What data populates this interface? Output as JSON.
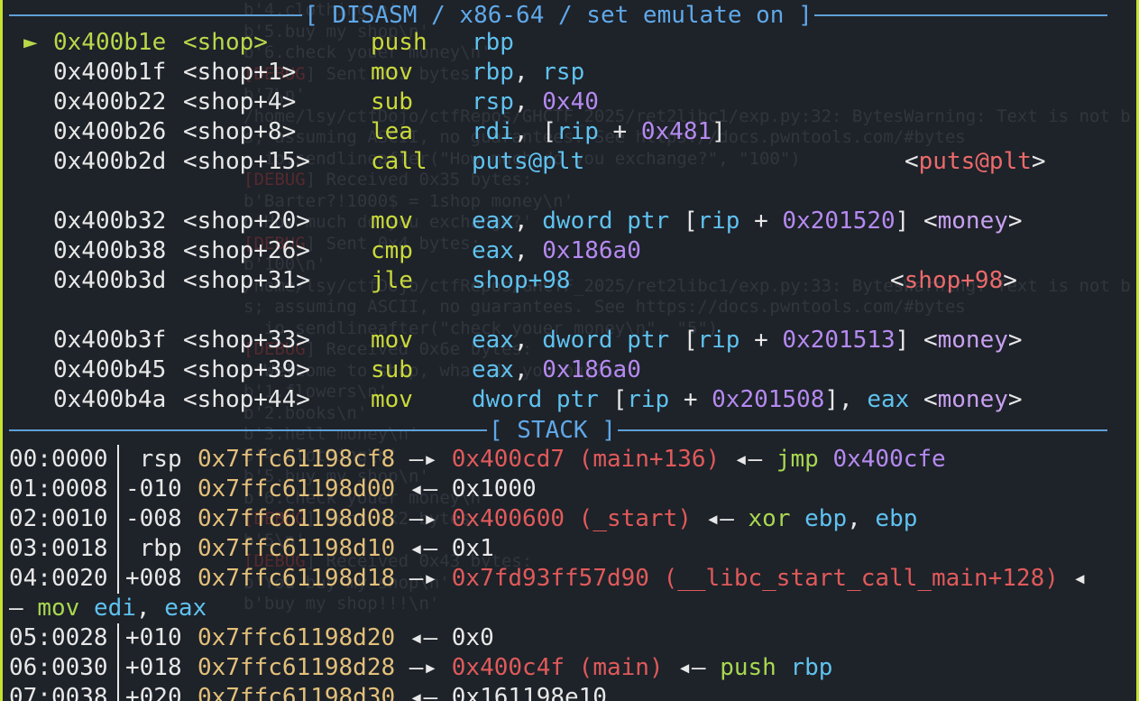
{
  "ghost_lines": [
    {
      "text": "b'4.clothing\\n'",
      "debug": ""
    },
    {
      "text": "b'5.buy my shop\\n'",
      "debug": ""
    },
    {
      "text": "b'6.check youer money\\n'",
      "debug": ""
    },
    {
      "text": "] Sent 0x2 bytes:",
      "debug": "[DEBUG"
    },
    {
      "text": "b'7\\n'",
      "debug": ""
    },
    {
      "text": "/home/lsy/ctfDojo/ctfRepos/GHCTF_2025/ret2libc1/exp.py:32: BytesWarning: Text is not byte",
      "debug": ""
    },
    {
      "text": "s; assuming ASCII, no guarantees. See https://docs.pwntools.com/#bytes",
      "debug": ""
    },
    {
      "text": "  io.sendlineafter(\"How much do you exchange?\", \"100\")",
      "debug": ""
    },
    {
      "text": "] Received 0x35 bytes:",
      "debug": "[DEBUG"
    },
    {
      "text": "b'Barter?!1000$ = 1shop money\\n'",
      "debug": ""
    },
    {
      "text": "b'How much do you exchange?'",
      "debug": ""
    },
    {
      "text": "] Sent 0x4 bytes:",
      "debug": "[DEBUG"
    },
    {
      "text": "b'100\\n'",
      "debug": ""
    },
    {
      "text": "/home/lsy/ctfDojo/ctfRepos/GHCTF_2025/ret2libc1/exp.py:33: BytesWarning: Text is not byte",
      "debug": ""
    },
    {
      "text": "s; assuming ASCII, no guarantees. See https://docs.pwntools.com/#bytes",
      "debug": ""
    },
    {
      "text": "  io.sendlineafter(\"check youer money\\n\", \"5\")",
      "debug": ""
    },
    {
      "text": "] Received 0x6e bytes:",
      "debug": "[DEBUG"
    },
    {
      "text": "b'Welcome to shop, what do you buy?\\n'",
      "debug": ""
    },
    {
      "text": "b'1.flowers\\n'",
      "debug": ""
    },
    {
      "text": "b'2.books\\n'",
      "debug": ""
    },
    {
      "text": "b'3.hell money\\n'",
      "debug": ""
    },
    {
      "text": "b'4.clothing\\n'",
      "debug": ""
    },
    {
      "text": "b'5.buy my shop\\n'",
      "debug": ""
    },
    {
      "text": "b'6.check youer money\\n'",
      "debug": ""
    },
    {
      "text": "] Sent 0x2 bytes:",
      "debug": "[DEBUG"
    },
    {
      "text": "b'5\\n'",
      "debug": ""
    },
    {
      "text": "] Received 0x43 bytes:",
      "debug": "[DEBUG"
    },
    {
      "text": "b'You buy my shop\\n'",
      "debug": ""
    },
    {
      "text": "b'buy my shop!!!\\n'",
      "debug": ""
    }
  ],
  "disasm": {
    "title": "[ DISASM / x86-64 / set emulate on ]",
    "current_marker": "►",
    "rows": [
      {
        "addr": "0x400b1e",
        "sym": "<shop>",
        "mn": "push",
        "ops": [
          [
            "op",
            "rbp"
          ]
        ],
        "ann": [],
        "current": true
      },
      {
        "addr": "0x400b1f",
        "sym": "<shop+1>",
        "mn": "mov",
        "ops": [
          [
            "op",
            "rbp"
          ],
          [
            "white",
            ", "
          ],
          [
            "op",
            "rsp"
          ]
        ],
        "ann": []
      },
      {
        "addr": "0x400b22",
        "sym": "<shop+4>",
        "mn": "sub",
        "ops": [
          [
            "op",
            "rsp"
          ],
          [
            "white",
            ", "
          ],
          [
            "num",
            "0x40"
          ]
        ],
        "ann": []
      },
      {
        "addr": "0x400b26",
        "sym": "<shop+8>",
        "mn": "lea",
        "ops": [
          [
            "op",
            "rdi"
          ],
          [
            "white",
            ", ["
          ],
          [
            "op",
            "rip"
          ],
          [
            "white",
            " + "
          ],
          [
            "num",
            "0x481"
          ],
          [
            "white",
            "]"
          ]
        ],
        "ann": []
      },
      {
        "addr": "0x400b2d",
        "sym": "<shop+15>",
        "mn": "call",
        "ops": [
          [
            "op",
            "puts@plt"
          ]
        ],
        "ann": [
          [
            "white",
            "<"
          ],
          [
            "pink",
            "puts@plt"
          ],
          [
            "white",
            ">"
          ]
        ],
        "ann_col": 1003
      },
      {
        "blank": true
      },
      {
        "addr": "0x400b32",
        "sym": "<shop+20>",
        "mn": "mov",
        "ops": [
          [
            "op",
            "eax"
          ],
          [
            "white",
            ", "
          ],
          [
            "op",
            "dword ptr"
          ],
          [
            "white",
            " ["
          ],
          [
            "op",
            "rip"
          ],
          [
            "white",
            " + "
          ],
          [
            "num",
            "0x201520"
          ],
          [
            "white",
            "]"
          ]
        ],
        "ann": [
          [
            "white",
            " <"
          ],
          [
            "sym",
            "money"
          ],
          [
            "white",
            ">"
          ]
        ]
      },
      {
        "addr": "0x400b38",
        "sym": "<shop+26>",
        "mn": "cmp",
        "ops": [
          [
            "op",
            "eax"
          ],
          [
            "white",
            ", "
          ],
          [
            "num",
            "0x186a0"
          ]
        ],
        "ann": []
      },
      {
        "addr": "0x400b3d",
        "sym": "<shop+31>",
        "mn": "jle",
        "ops": [
          [
            "op",
            "shop+98"
          ]
        ],
        "ann": [
          [
            "white",
            "<"
          ],
          [
            "pink",
            "shop+98"
          ],
          [
            "white",
            ">"
          ]
        ],
        "ann_col": 987
      },
      {
        "blank": true
      },
      {
        "addr": "0x400b3f",
        "sym": "<shop+33>",
        "mn": "mov",
        "ops": [
          [
            "op",
            "eax"
          ],
          [
            "white",
            ", "
          ],
          [
            "op",
            "dword ptr"
          ],
          [
            "white",
            " ["
          ],
          [
            "op",
            "rip"
          ],
          [
            "white",
            " + "
          ],
          [
            "num",
            "0x201513"
          ],
          [
            "white",
            "]"
          ]
        ],
        "ann": [
          [
            "white",
            " <"
          ],
          [
            "sym",
            "money"
          ],
          [
            "white",
            ">"
          ]
        ]
      },
      {
        "addr": "0x400b45",
        "sym": "<shop+39>",
        "mn": "sub",
        "ops": [
          [
            "op",
            "eax"
          ],
          [
            "white",
            ", "
          ],
          [
            "num",
            "0x186a0"
          ]
        ],
        "ann": []
      },
      {
        "addr": "0x400b4a",
        "sym": "<shop+44>",
        "mn": "mov",
        "ops": [
          [
            "op",
            "dword ptr"
          ],
          [
            "white",
            " ["
          ],
          [
            "op",
            "rip"
          ],
          [
            "white",
            " + "
          ],
          [
            "num",
            "0x201508"
          ],
          [
            "white",
            "], "
          ],
          [
            "op",
            "eax"
          ]
        ],
        "ann": [
          [
            "white",
            " <"
          ],
          [
            "sym",
            "money"
          ],
          [
            "white",
            ">"
          ]
        ]
      }
    ]
  },
  "stack": {
    "title": "[ STACK ]",
    "rows": [
      {
        "idx": "00:0000",
        "reg": " rsp",
        "addr": "0x7ffc61198cf8",
        "chain": [
          [
            "white",
            " —▸ "
          ],
          [
            "code",
            "0x400cd7 (main+136)"
          ],
          [
            "white",
            " ◂— "
          ],
          [
            "instr",
            "jmp "
          ],
          [
            "num",
            "0x400cfe"
          ]
        ]
      },
      {
        "idx": "01:0008",
        "reg": "-010",
        "addr": "0x7ffc61198d00",
        "chain": [
          [
            "white",
            " ◂— 0x1000"
          ]
        ]
      },
      {
        "idx": "02:0010",
        "reg": "-008",
        "addr": "0x7ffc61198d08",
        "chain": [
          [
            "white",
            " —▸ "
          ],
          [
            "code",
            "0x400600 (_start)"
          ],
          [
            "white",
            " ◂— "
          ],
          [
            "instr",
            "xor "
          ],
          [
            "op",
            "ebp"
          ],
          [
            "white",
            ", "
          ],
          [
            "op",
            "ebp"
          ]
        ]
      },
      {
        "idx": "03:0018",
        "reg": " rbp",
        "addr": "0x7ffc61198d10",
        "chain": [
          [
            "white",
            " ◂— 0x1"
          ]
        ]
      },
      {
        "idx": "04:0020",
        "reg": "+008",
        "addr": "0x7ffc61198d18",
        "chain": [
          [
            "white",
            " —▸ "
          ],
          [
            "code",
            "0x7fd93ff57d90 (__libc_start_call_main+128)"
          ],
          [
            "white",
            " ◂"
          ]
        ],
        "wrap": [
          [
            "white",
            "— "
          ],
          [
            "instr",
            "mov "
          ],
          [
            "op",
            "edi"
          ],
          [
            "white",
            ", "
          ],
          [
            "op",
            "eax"
          ]
        ]
      },
      {
        "idx": "05:0028",
        "reg": "+010",
        "addr": "0x7ffc61198d20",
        "chain": [
          [
            "white",
            " ◂— 0x0"
          ]
        ]
      },
      {
        "idx": "06:0030",
        "reg": "+018",
        "addr": "0x7ffc61198d28",
        "chain": [
          [
            "white",
            " —▸ "
          ],
          [
            "code",
            "0x400c4f (main)"
          ],
          [
            "white",
            " ◂— "
          ],
          [
            "instr",
            "push "
          ],
          [
            "op",
            "rbp"
          ]
        ]
      },
      {
        "idx": "07:0038",
        "reg": "+020",
        "addr": "0x7ffc61198d30",
        "chain": [
          [
            "white",
            " ◂— 0x161198e10"
          ]
        ]
      }
    ]
  }
}
